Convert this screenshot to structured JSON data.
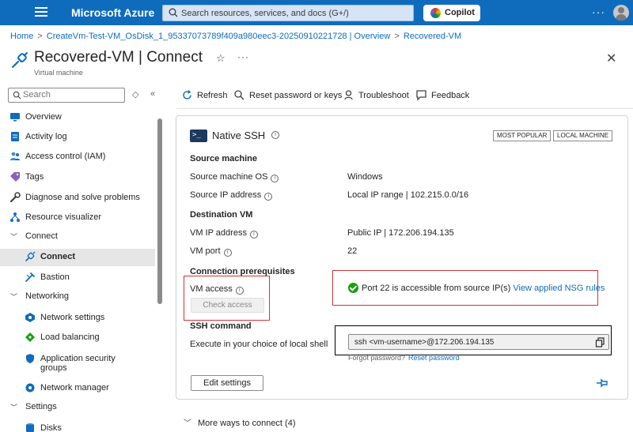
{
  "topbar": {
    "brand": "Microsoft Azure",
    "search_placeholder": "Search resources, services, and docs (G+/)",
    "copilot_label": "Copilot",
    "more_label": "···"
  },
  "breadcrumb": [
    {
      "label": "Home"
    },
    {
      "label": "CreateVm-Test-VM_OsDisk_1_95337073789f409a980eec3-20250910221728 | Overview"
    },
    {
      "label": "Recovered-VM"
    }
  ],
  "breadcrumb_separator": ">",
  "header": {
    "title": "Recovered-VM | Connect",
    "subtitle": "Virtual machine",
    "star": "☆",
    "more": "···",
    "close": "✕"
  },
  "sidebar": {
    "search_placeholder": "Search",
    "items": [
      {
        "label": "Overview",
        "icon": "monitor-icon",
        "type": "item"
      },
      {
        "label": "Activity log",
        "icon": "activity-log-icon",
        "type": "item"
      },
      {
        "label": "Access control (IAM)",
        "icon": "people-icon",
        "type": "item"
      },
      {
        "label": "Tags",
        "icon": "tag-icon",
        "type": "item"
      },
      {
        "label": "Diagnose and solve problems",
        "icon": "wrench-icon",
        "type": "item"
      },
      {
        "label": "Resource visualizer",
        "icon": "hierarchy-icon",
        "type": "item"
      },
      {
        "label": "Connect",
        "type": "group"
      },
      {
        "label": "Connect",
        "icon": "plug-icon",
        "type": "subitem",
        "active": true
      },
      {
        "label": "Bastion",
        "icon": "bastion-icon",
        "type": "subitem"
      },
      {
        "label": "Networking",
        "type": "group"
      },
      {
        "label": "Network settings",
        "icon": "network-icon",
        "type": "subitem"
      },
      {
        "label": "Load balancing",
        "icon": "load-balancer-icon",
        "type": "subitem"
      },
      {
        "label": "Application security groups",
        "icon": "security-group-icon",
        "type": "subitem"
      },
      {
        "label": "Network manager",
        "icon": "network-manager-icon",
        "type": "subitem"
      },
      {
        "label": "Settings",
        "type": "group"
      },
      {
        "label": "Disks",
        "icon": "disk-icon",
        "type": "subitem"
      }
    ]
  },
  "toolbar": {
    "refresh": "Refresh",
    "reset_password": "Reset password or keys",
    "troubleshoot": "Troubleshoot",
    "feedback": "Feedback"
  },
  "card": {
    "title": "Native SSH",
    "badges": [
      "MOST POPULAR",
      "LOCAL MACHINE"
    ],
    "source_machine": {
      "heading": "Source machine",
      "os_label": "Source machine OS",
      "os_value": "Windows",
      "ip_label": "Source IP address",
      "ip_value": "Local IP range | 102.215.0.0/16"
    },
    "destination_vm": {
      "heading": "Destination VM",
      "ip_label": "VM IP address",
      "ip_value": "Public IP | 172.206.194.135",
      "port_label": "VM port",
      "port_value": "22"
    },
    "prerequisites": {
      "heading": "Connection prerequisites",
      "vm_access_label": "VM access",
      "check_access_button": "Check access",
      "port_status": "Port 22 is accessible from source IP(s)",
      "nsg_link": "View applied NSG rules"
    },
    "ssh_command": {
      "heading": "SSH command",
      "label": "Execute in your choice of local shell",
      "command": "ssh <vm-username>@172.206.194.135",
      "forgot_password": "Forgot password?",
      "reset_password": "Reset password"
    },
    "edit_settings": "Edit settings"
  },
  "more_ways": "More ways to connect (4)",
  "colors": {
    "azure_blue": "#0f6cbd",
    "success_green": "#13a10e",
    "highlight_red": "#d13438"
  }
}
